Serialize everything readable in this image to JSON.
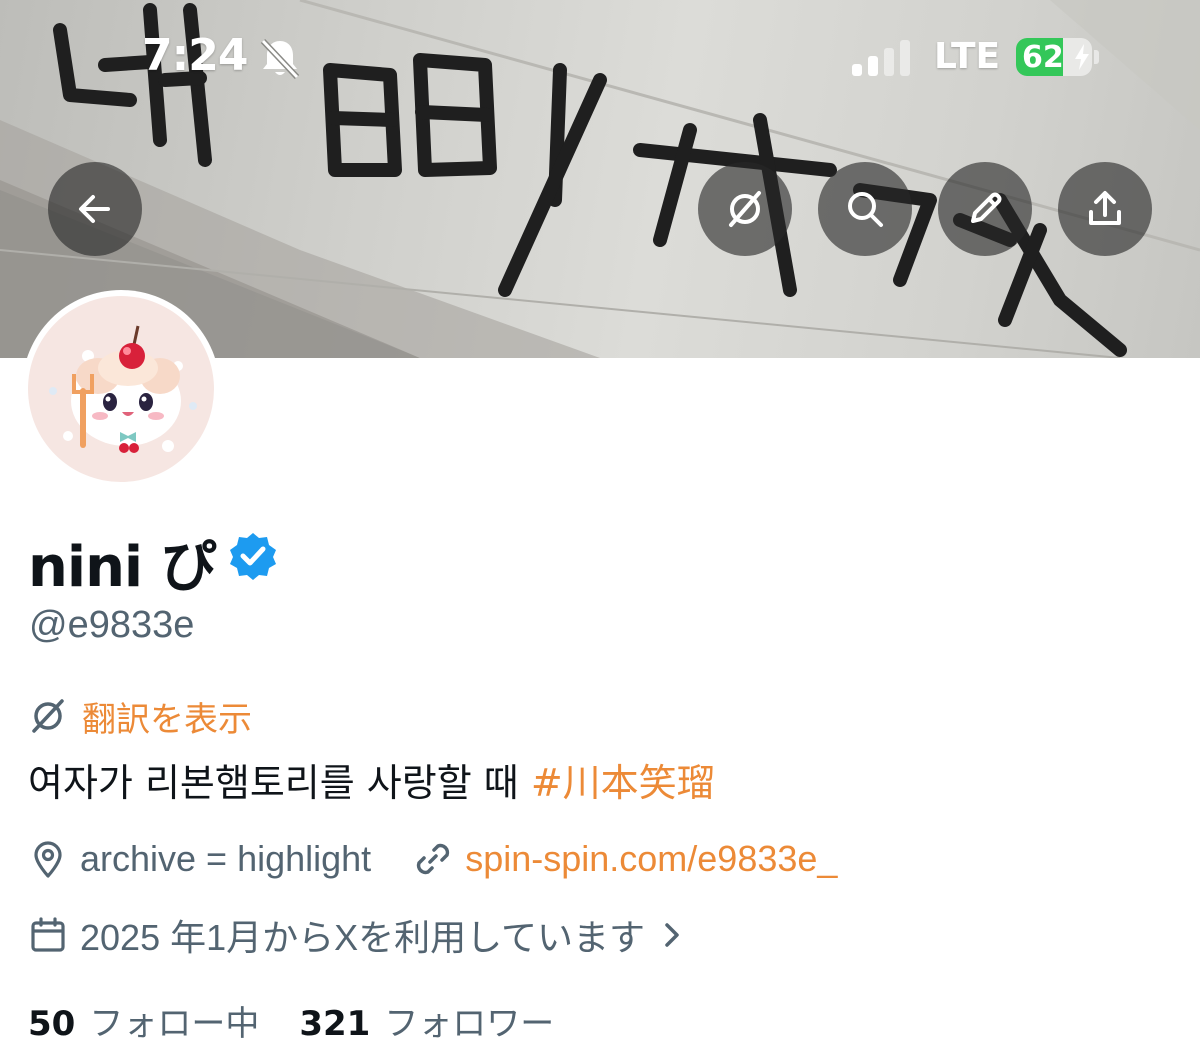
{
  "status_bar": {
    "time": "7:24",
    "network": "LTE",
    "battery_percent": "62",
    "battery_level": 0.62
  },
  "header": {
    "buttons": [
      {
        "name": "back",
        "icon": "arrow-left-icon"
      },
      {
        "name": "translate",
        "icon": "translate-icon"
      },
      {
        "name": "search",
        "icon": "search-icon"
      },
      {
        "name": "edit",
        "icon": "pencil-icon"
      },
      {
        "name": "share",
        "icon": "share-icon"
      }
    ]
  },
  "banner": {
    "handwritten_text": "니어삐ㅣ サランハ"
  },
  "profile": {
    "display_name": "nini ぴ",
    "verified": true,
    "handle": "@e9833e",
    "translate_label": "翻訳を表示",
    "bio_text": "여자가 리본햄토리를 사랑할 때 ",
    "bio_hashtag": "#川本笑瑠",
    "location": "archive = highlight",
    "website": "spin-spin.com/e9833e_",
    "joined": "2025 年1月からXを利用しています",
    "following_count": "50",
    "following_label": "フォロー中",
    "followers_count": "321",
    "followers_label": "フォロワー"
  },
  "colors": {
    "accent": "#ec8a37",
    "verified_blue": "#1d9bf0",
    "secondary_text": "#536471",
    "battery_green": "#34c759"
  }
}
